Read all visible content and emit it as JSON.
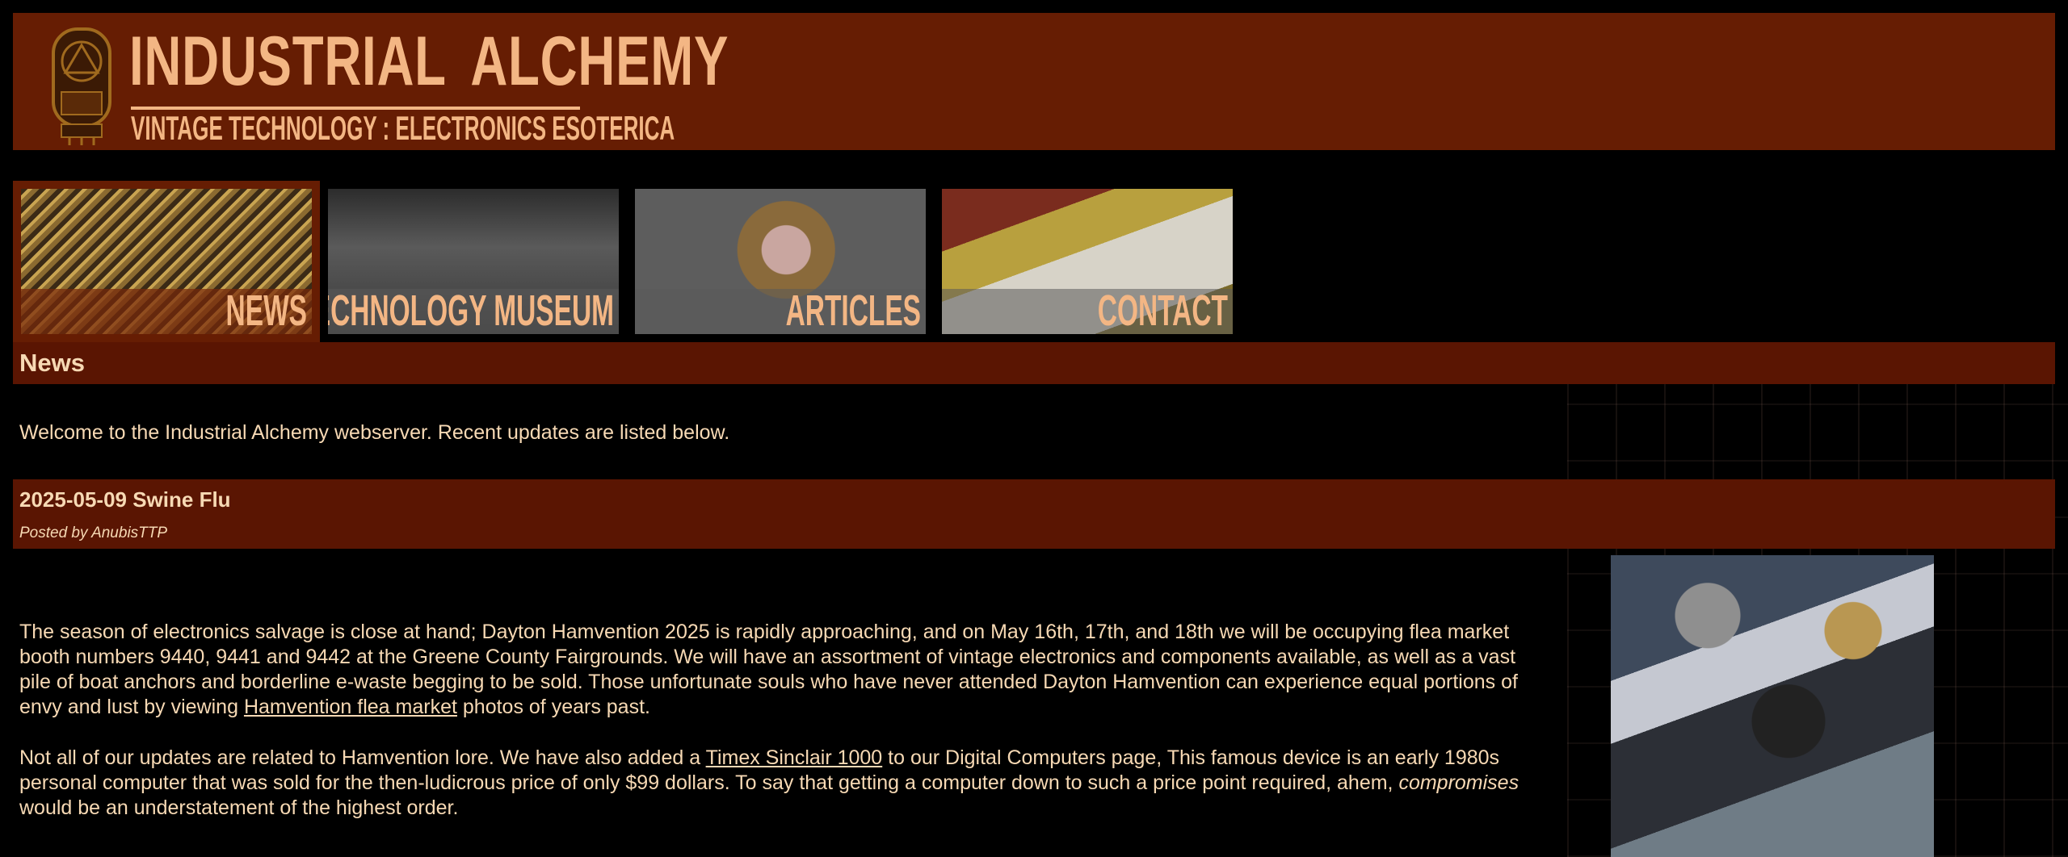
{
  "header": {
    "title_left": "INDUSTRIAL",
    "title_right": "ALCHEMY",
    "subtitle": "VINTAGE TECHNOLOGY : ELECTRONICS ESOTERICA"
  },
  "nav": {
    "items": [
      {
        "label": "NEWS",
        "active": true
      },
      {
        "label": "TECHNOLOGY MUSEUM",
        "active": false
      },
      {
        "label": "ARTICLES",
        "active": false
      },
      {
        "label": "CONTACT",
        "active": false
      }
    ]
  },
  "section": {
    "title": "News"
  },
  "intro": "Welcome to the Industrial Alchemy webserver. Recent updates are listed below.",
  "post": {
    "title": "2025-05-09 Swine Flu",
    "meta": "Posted by AnubisTTP",
    "p1_before": "The season of electronics salvage is close at hand; Dayton Hamvention 2025 is rapidly approaching, and on May 16th, 17th, and 18th we will be occupying flea market booth numbers 9440, 9441 and 9442 at the Greene County Fairgrounds. We will have an assortment of vintage electronics and components available, as well as a vast pile of boat anchors and borderline e-waste begging to be sold. Those unfortunate souls who have never attended Dayton Hamvention can experience equal portions of envy and lust by viewing ",
    "p1_link": "Hamvention flea market",
    "p1_after": " photos of years past.",
    "p2_before": "Not all of our updates are related to Hamvention lore. We have also added a ",
    "p2_link": "Timex Sinclair 1000",
    "p2_middle": " to our Digital Computers page, This famous device is an early 1980s personal computer that was sold for the then-ludicrous price of only $99 dollars. To say that getting a computer down to such a price point required, ahem, ",
    "p2_em": "compromises",
    "p2_after": " would be an understatement of the highest order."
  },
  "colors": {
    "background": "#000000",
    "header_bg": "#661d03",
    "bar_bg": "#5a1502",
    "text": "#f7d9b4",
    "logo_text": "#f3b684"
  }
}
